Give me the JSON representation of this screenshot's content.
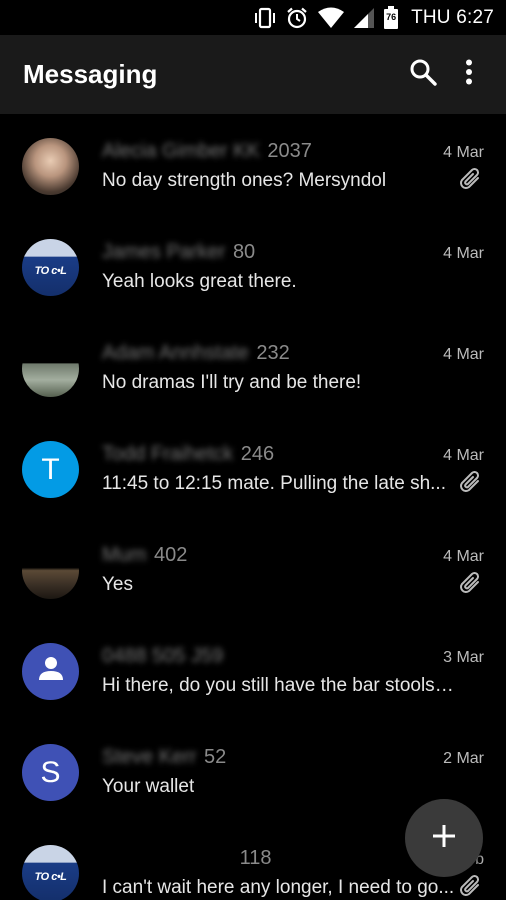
{
  "status_bar": {
    "battery_level": "76",
    "time": "THU 6:27",
    "icons": [
      "vibrate-icon",
      "alarm-icon",
      "wifi-icon",
      "signal-icon",
      "battery-icon"
    ]
  },
  "app_bar": {
    "title": "Messaging",
    "actions": [
      "search-icon",
      "more-vert-icon"
    ]
  },
  "conversations": [
    {
      "name": "Alecia Gimber KK",
      "count": "2037",
      "date": "4 Mar",
      "snippet": "No day strength ones?  Mersyndol",
      "attachment": true,
      "avatar": "photo"
    },
    {
      "name": "James Parker",
      "count": "80",
      "date": "4 Mar",
      "snippet": "Yeah looks great there.",
      "attachment": false,
      "avatar": "photo"
    },
    {
      "name": "Adam Annhstate",
      "count": "232",
      "date": "4 Mar",
      "snippet": "No dramas I'll try and be there!",
      "attachment": false,
      "avatar": "photo"
    },
    {
      "name": "Todd Fraihetck",
      "count": "246",
      "date": "4 Mar",
      "snippet": "11:45 to 12:15 mate. Pulling the late sh...",
      "attachment": true,
      "avatar": "letter",
      "letter": "T",
      "color": "#039be5"
    },
    {
      "name": "Mum",
      "count": "402",
      "date": "4 Mar",
      "snippet": "Yes",
      "attachment": true,
      "avatar": "photo"
    },
    {
      "name": "0488 505 J59",
      "count": "",
      "date": "3 Mar",
      "snippet": "Hi there, do you still have the bar stools fo...",
      "attachment": false,
      "avatar": "person",
      "color": "#3f51b5"
    },
    {
      "name": "Steve Kerr",
      "count": "52",
      "date": "2 Mar",
      "snippet": "Your wallet",
      "attachment": false,
      "avatar": "letter",
      "letter": "S",
      "color": "#3f51b5"
    },
    {
      "name": "",
      "count": "118",
      "date": "eb",
      "snippet": "I can't wait here any longer, I need to go...",
      "attachment": true,
      "avatar": "photo"
    }
  ],
  "fab": {
    "icon": "plus-icon"
  },
  "colors": {
    "app_bar": "#1a1a1a",
    "background": "#000000",
    "fab": "#3a3a3a",
    "letter_blue": "#039be5",
    "indigo": "#3f51b5"
  }
}
